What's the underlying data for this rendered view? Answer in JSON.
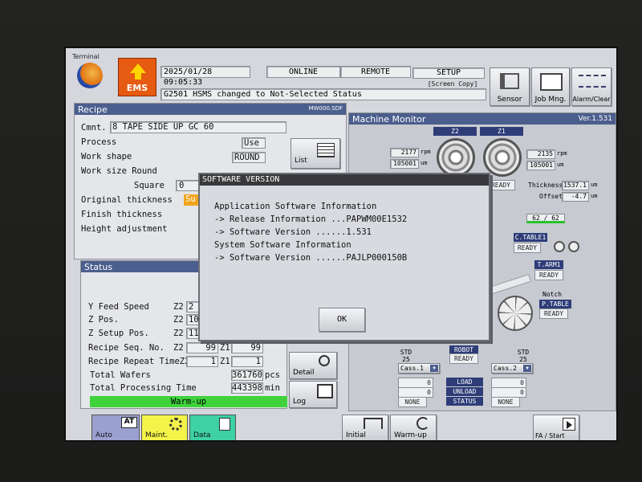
{
  "header": {
    "terminal_label": "Terminal",
    "ems_label": "EMS",
    "datetime": "2025/01/28 09:05:33",
    "online": "ONLINE",
    "remote": "REMOTE",
    "setup": "SETUP",
    "screen_copy": "[Screen Copy]",
    "message": "G2501  HSMS changed to Not-Selected Status",
    "sensor": "Sensor",
    "job_mng": "Job Mng.",
    "alarm_clear": "Alarm/Clear"
  },
  "recipe": {
    "title": "Recipe",
    "file": "MW000.SDF",
    "comment_label": "Cmnt.",
    "comment_value": "8 TAPE SIDE UP GC  60",
    "process_label": "Process",
    "process_value": "Use",
    "work_shape_label": "Work shape",
    "work_shape_value": "ROUND",
    "work_size_label": "Work size Round",
    "square_label": "Square",
    "square_value": "0",
    "original_thickness_label": "Original thickness",
    "original_thickness_value": "Su",
    "finish_thickness_label": "Finish thickness",
    "height_adjustment_label": "Height adjustment",
    "list_button": "List"
  },
  "status": {
    "title": "Status",
    "y_feed_label": "Y Feed Speed",
    "y_feed_z2": "Z2",
    "y_feed_value": "2",
    "z_pos_label": "Z Pos.",
    "z_pos_z2": "Z2",
    "z_pos_value": "10",
    "z_setup_label": "Z Setup Pos.",
    "z_setup_z2": "Z2",
    "z_setup_value": "11",
    "seq_label": "Recipe Seq. No.",
    "seq_z2": "Z2",
    "seq_z2_value": "99",
    "seq_z1": "Z1",
    "seq_z1_value": "99",
    "repeat_label": "Recipe Repeat TimeZ2",
    "repeat_z2_value": "1",
    "repeat_z1": "Z1",
    "repeat_z1_value": "1",
    "total_wafers_label": "Total Wafers",
    "total_wafers_value": "361760",
    "total_wafers_unit": "pcs",
    "total_time_label": "Total Processing Time",
    "total_time_value": "443398",
    "total_time_unit": "min",
    "warmup_status": "Warm-up",
    "detail_button": "Detail",
    "log_button": "Log"
  },
  "machine": {
    "title": "Machine Monitor",
    "version": "Ver.1.531",
    "z2_label": "Z2",
    "z1_label": "Z1",
    "z2_rpm": "2177",
    "z2_rpm_unit": "rpm",
    "z2_um": "105001",
    "z2_um_unit": "um",
    "z1_rpm": "2135",
    "z1_rpm_unit": "rpm",
    "z1_um": "105001",
    "z1_um_unit": "um",
    "ready": "READY",
    "thickness_label": "Thickness",
    "thickness_value": "1537.1",
    "thickness_unit": "um",
    "offset_label": "Offset",
    "offset_value": "-4.7",
    "offset_unit": "um",
    "ratio": "62 /  62",
    "ctable": "C.TABLE1",
    "tarm": "T.ARM1",
    "notch": "Notch",
    "ptable": "P.TABLE",
    "std_left": "STD",
    "std_left_n": "25",
    "std_right": "STD",
    "std_right_n": "25",
    "robot": "ROBOT",
    "cass1": "Cass.1",
    "cass2": "Cass.2",
    "cass1_v1": "0",
    "cass1_v2": "0",
    "cass1_state": "NONE",
    "cass2_v1": "0",
    "cass2_v2": "0",
    "cass2_state": "NONE",
    "load": "LOAD",
    "unload": "UNLOAD",
    "status_lbl": "STATUS"
  },
  "dialog": {
    "title": "SOFTWARE VERSION",
    "app_info": "Application Software Information",
    "release_line": "-> Release Information ...PAPWM00E1532",
    "app_version_line": "-> Software Version ......1.531",
    "system_info": "System Software Information",
    "system_version_line": "-> Software Version ......PAJLP000150B",
    "ok": "OK"
  },
  "bottom": {
    "auto": "Auto",
    "auto_icon": "AT",
    "maint": "Maint.",
    "data": "Data",
    "initial": "Initial",
    "warmup": "Warm-up",
    "fa_start": "FA / Start"
  }
}
